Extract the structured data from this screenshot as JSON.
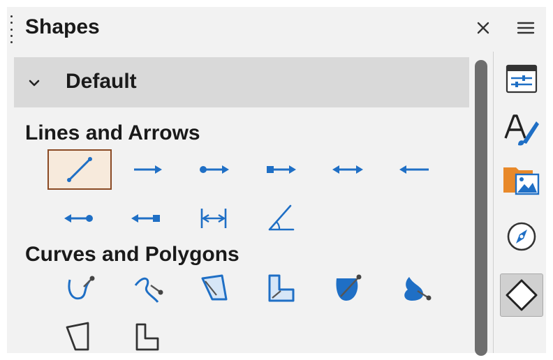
{
  "panel": {
    "title": "Shapes",
    "close_icon": "close-icon",
    "menu_icon": "hamburger-menu-icon"
  },
  "category": {
    "label": "Default",
    "expanded": true
  },
  "sections": [
    {
      "title": "Lines and Arrows",
      "shapes": [
        {
          "icon": "line-icon",
          "selected": true
        },
        {
          "icon": "line-ends-with-arrow-icon",
          "selected": false
        },
        {
          "icon": "line-circle-arrow-icon",
          "selected": false
        },
        {
          "icon": "line-square-arrow-icon",
          "selected": false
        },
        {
          "icon": "double-arrow-icon",
          "selected": false
        },
        {
          "icon": "line-starts-with-arrow-icon",
          "selected": false
        },
        {
          "icon": "line-with-circle-icon",
          "selected": false
        },
        {
          "icon": "line-with-square-icon",
          "selected": false
        },
        {
          "icon": "dimension-line-icon",
          "selected": false
        },
        {
          "icon": "line-45-icon",
          "selected": false
        }
      ]
    },
    {
      "title": "Curves and Polygons",
      "shapes": [
        {
          "icon": "curve-icon",
          "selected": false
        },
        {
          "icon": "freeform-line-icon",
          "selected": false
        },
        {
          "icon": "polygon-filled-icon",
          "selected": false
        },
        {
          "icon": "polygon-45-filled-icon",
          "selected": false
        },
        {
          "icon": "curve-filled-icon",
          "selected": false
        },
        {
          "icon": "freeform-filled-icon",
          "selected": false
        },
        {
          "icon": "polygon-icon",
          "selected": false
        },
        {
          "icon": "polygon-45-icon",
          "selected": false
        }
      ]
    }
  ],
  "deck": {
    "items": [
      {
        "icon": "properties-icon",
        "active": false
      },
      {
        "icon": "styles-icon",
        "active": false
      },
      {
        "icon": "gallery-icon",
        "active": false
      },
      {
        "icon": "navigator-icon",
        "active": false
      },
      {
        "icon": "shapes-icon",
        "active": true
      }
    ]
  },
  "colors": {
    "icon_blue": "#1f6fc5",
    "selected_border": "#8a4a24",
    "category_bg": "#d9d9d9",
    "panel_bg": "#f2f2f2"
  }
}
